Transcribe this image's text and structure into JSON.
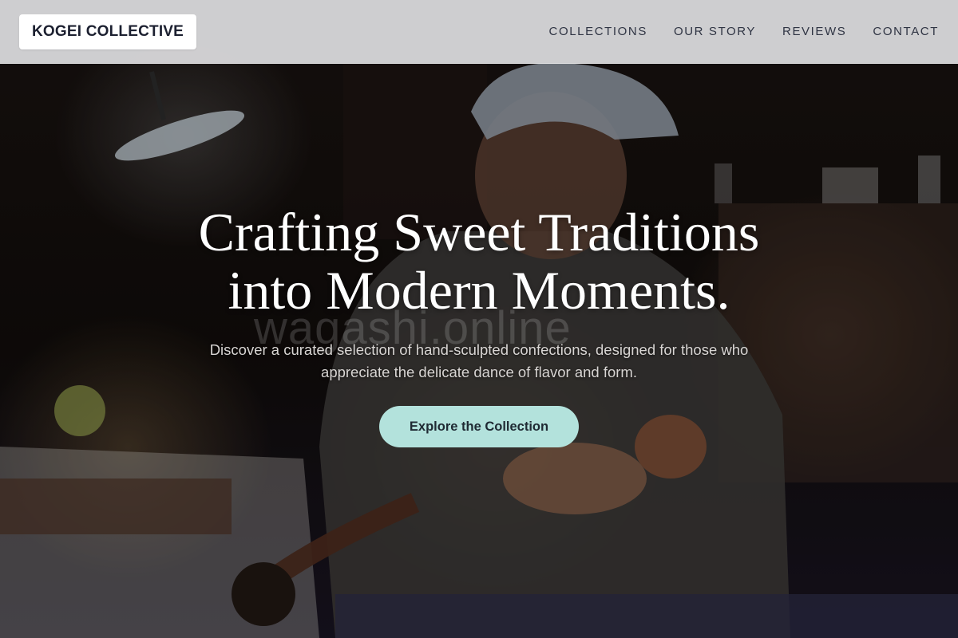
{
  "brand": {
    "logo_text": "KOGEI COLLECTIVE"
  },
  "nav": {
    "items": [
      {
        "label": "COLLECTIONS"
      },
      {
        "label": "OUR STORY"
      },
      {
        "label": "REVIEWS"
      },
      {
        "label": "CONTACT"
      }
    ]
  },
  "hero": {
    "headline_line1": "Crafting Sweet Traditions",
    "headline_line2": "into Modern Moments.",
    "subtext": "Discover a curated selection of hand-sculpted confections, designed for those who appreciate the delicate dance of flavor and form.",
    "cta_label": "Explore the Collection",
    "watermark": "wagashi.online",
    "background_image": "artisan-craftsman-workshop-photo"
  },
  "colors": {
    "nav_bg": "#d6d6d8",
    "logo_text": "#1c2030",
    "nav_text": "#2f3443",
    "cta_bg": "#b3e2dc",
    "cta_text": "#1f2a33",
    "headline": "#ffffff"
  }
}
